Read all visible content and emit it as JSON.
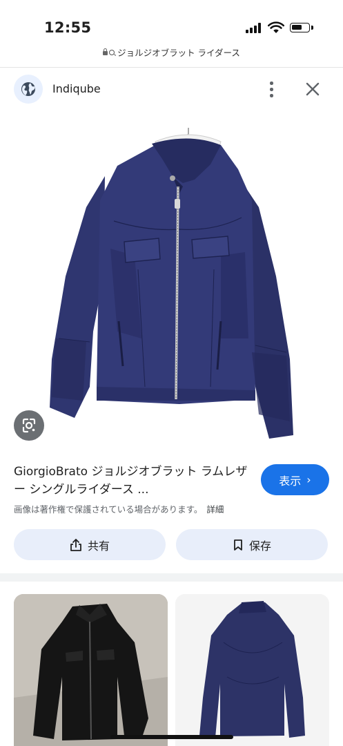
{
  "status_bar": {
    "time": "12:55",
    "battery_level": 0.62
  },
  "url_bar": {
    "query": "ジョルジオブラット ライダース"
  },
  "header": {
    "site_name": "Indiqube",
    "icons": [
      "globe-icon",
      "more-vert-icon",
      "close-icon"
    ]
  },
  "result": {
    "title": "GiorgioBrato ジョルジオブラット ラムレザー シングルライダース ...",
    "visit_label": "表示",
    "copyright_note": "画像は著作権で保護されている場合があります。",
    "details_label": "詳細",
    "share_label": "共有",
    "save_label": "保存"
  },
  "colors": {
    "accent": "#1a73e8",
    "action_bg": "#e8eefa",
    "jacket": "#2f3670"
  }
}
